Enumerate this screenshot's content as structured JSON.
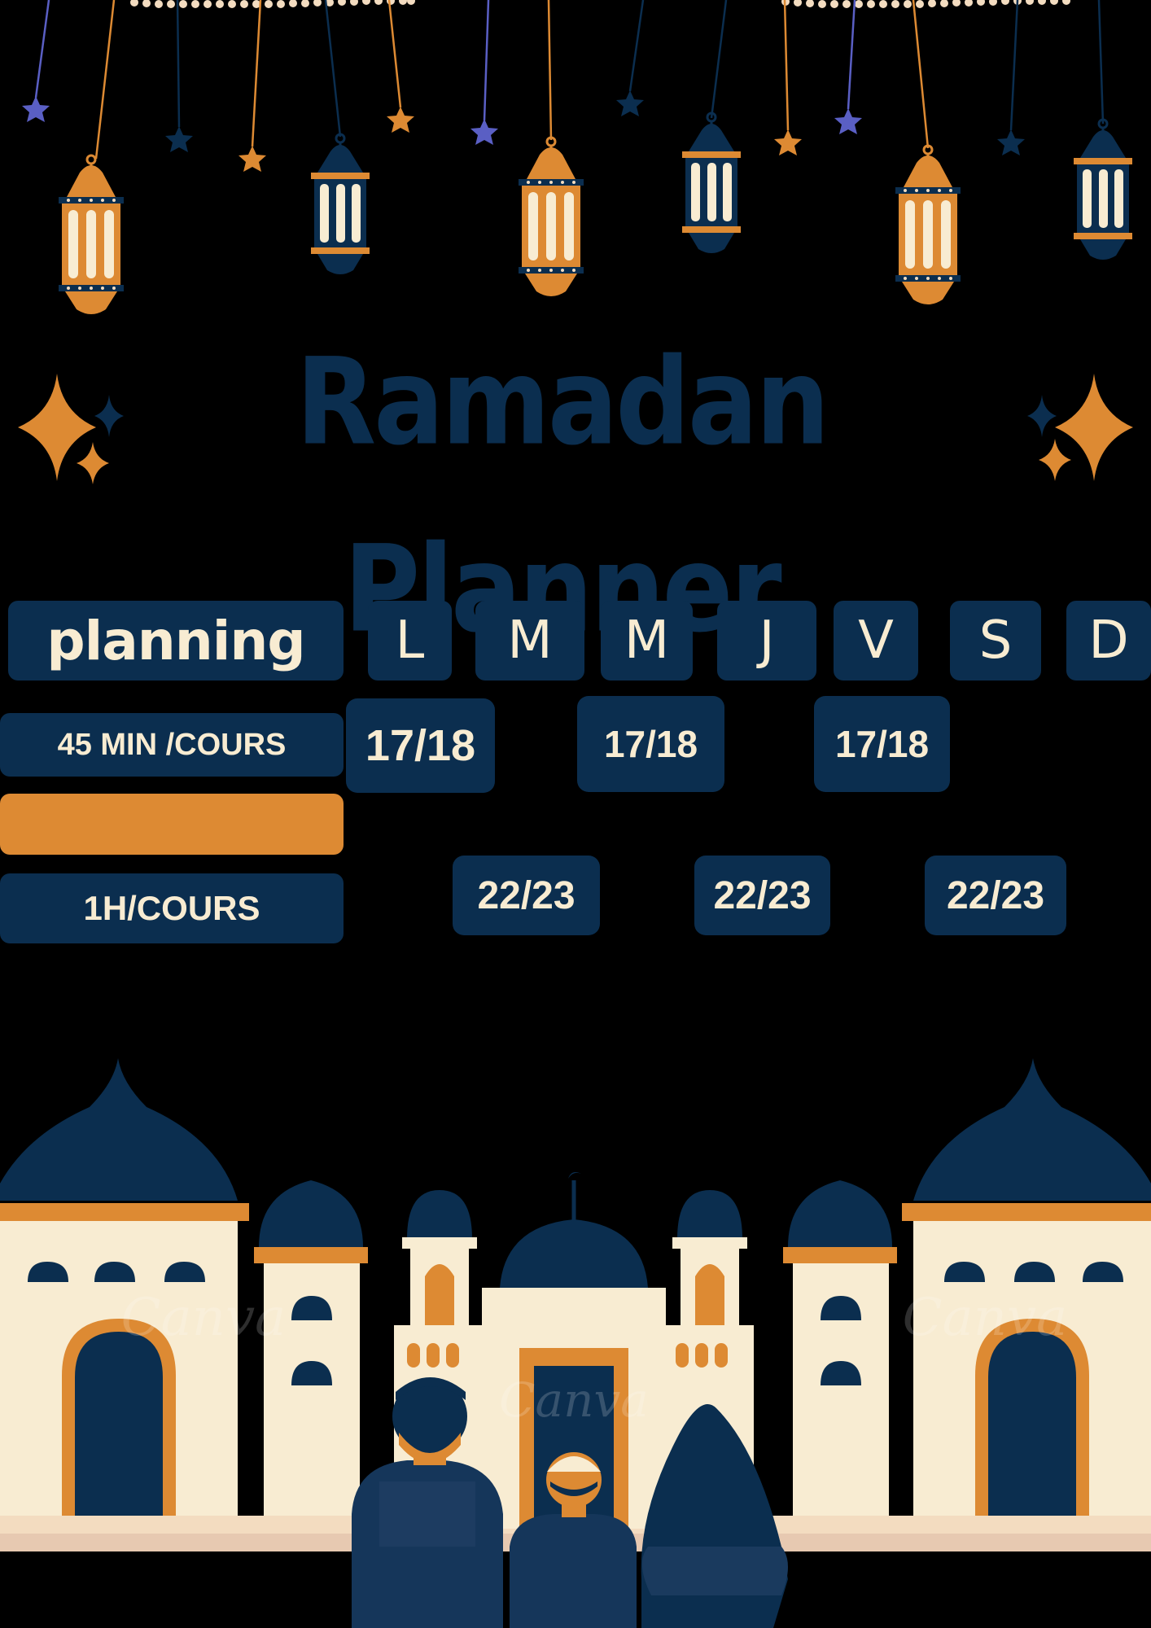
{
  "title": "Ramadan Planner",
  "colors": {
    "navy": "#0b2e4f",
    "orange": "#dd8a33",
    "cream": "#f8ecd2",
    "background": "#000000"
  },
  "schedule": {
    "header_label": "planning",
    "days": [
      "L",
      "M",
      "M",
      "J",
      "V",
      "S",
      "D"
    ],
    "rows": [
      {
        "label": "45 MIN /COURS",
        "slots": [
          "17/18",
          "17/18",
          "17/18"
        ]
      },
      {
        "label": "",
        "slots": []
      },
      {
        "label": "1H/COURS",
        "slots": [
          "22/23",
          "22/23",
          "22/23"
        ]
      }
    ]
  },
  "watermark": "Canva"
}
